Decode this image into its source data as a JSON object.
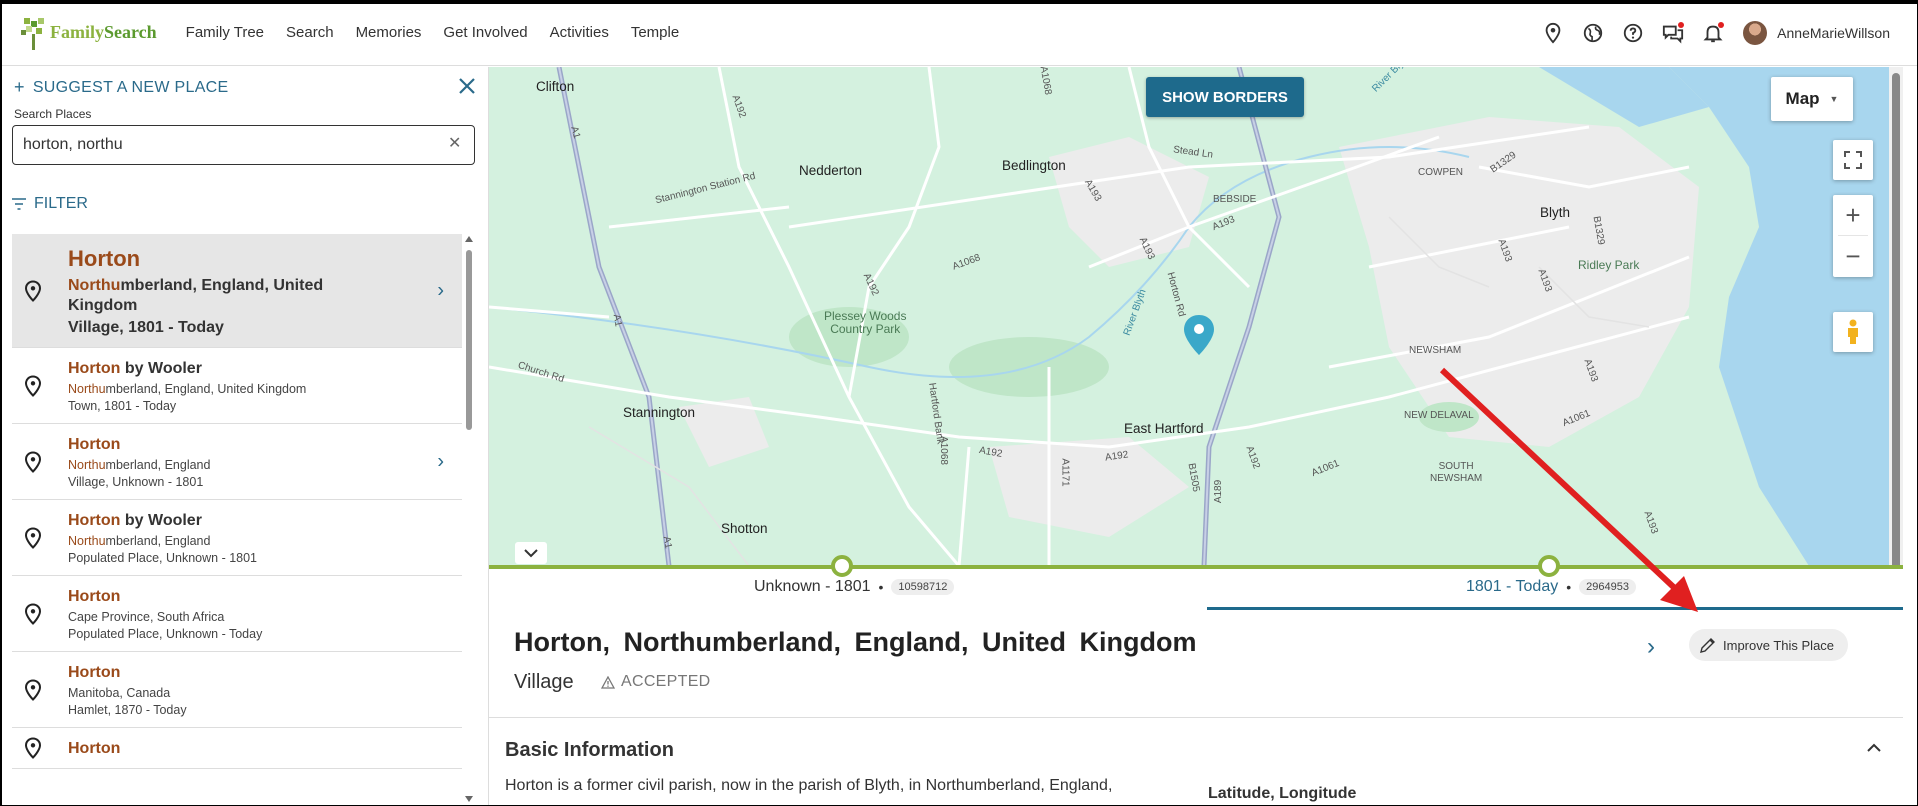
{
  "header": {
    "logo_text_1": "Family",
    "logo_text_2": "Search",
    "nav": [
      "Family Tree",
      "Search",
      "Memories",
      "Get Involved",
      "Activities",
      "Temple"
    ],
    "username": "AnneMarieWillson",
    "icons": [
      "location-pin-icon",
      "globe-icon",
      "help-icon",
      "chat-icon",
      "bell-icon"
    ]
  },
  "sidebar": {
    "suggest_label": "SUGGEST A NEW PLACE",
    "search_label": "Search Places",
    "search_value": "horton, northu",
    "filter_label": "FILTER",
    "results": [
      {
        "name_hl": "Horton",
        "name_rest": "",
        "loc_hl": "Northu",
        "loc_rest": "mberland, England, United Kingdom",
        "type": "Village, 1801 - Today",
        "selected": true,
        "chevron": true
      },
      {
        "name_hl": "Horton",
        "name_rest": " by Wooler",
        "loc_hl": "Northu",
        "loc_rest": "mberland, England, United Kingdom",
        "type": "Town, 1801 - Today",
        "selected": false,
        "chevron": false
      },
      {
        "name_hl": "Horton",
        "name_rest": "",
        "loc_hl": "Northu",
        "loc_rest": "mberland, England",
        "type": "Village, Unknown - 1801",
        "selected": false,
        "chevron": true
      },
      {
        "name_hl": "Horton",
        "name_rest": " by Wooler",
        "loc_hl": "Northu",
        "loc_rest": "mberland, England",
        "type": "Populated Place, Unknown - 1801",
        "selected": false,
        "chevron": false
      },
      {
        "name_hl": "Horton",
        "name_rest": "",
        "loc_hl": "",
        "loc_rest": "Cape Province, South Africa",
        "type": "Populated Place, Unknown - Today",
        "selected": false,
        "chevron": false
      },
      {
        "name_hl": "Horton",
        "name_rest": "",
        "loc_hl": "",
        "loc_rest": "Manitoba, Canada",
        "type": "Hamlet, 1870 - Today",
        "selected": false,
        "chevron": false
      },
      {
        "name_hl": "Horton",
        "name_rest": "",
        "loc_hl": "",
        "loc_rest": "",
        "type": "",
        "selected": false,
        "chevron": false
      }
    ]
  },
  "map": {
    "show_borders": "SHOW BORDERS",
    "map_type": "Map",
    "labels": {
      "clifton": "Clifton",
      "nedderton": "Nedderton",
      "bedlington": "Bedlington",
      "stannington": "Stannington",
      "east_hartford": "East Hartford",
      "shotton": "Shotton",
      "blyth": "Blyth",
      "ridley_park": "Ridley Park",
      "plessey_woods_1": "Plessey Woods",
      "plessey_woods_2": "Country Park",
      "cowpen": "COWPEN",
      "bebside": "BEBSIDE",
      "newsham": "NEWSHAM",
      "new_delaval": "NEW DELAVAL",
      "south_newsham_1": "SOUTH",
      "south_newsham_2": "NEWSHAM",
      "stannington_station_rd": "Stannington Station Rd",
      "church_rd": "Church Rd",
      "hartford_bank": "Hartford Bank",
      "horton_rd": "Horton Rd",
      "stead_ln": "Stead Ln",
      "river_blyth": "River Blyth",
      "river_blyth_2": "River Blyth",
      "a192_1": "A192",
      "a192_2": "A192",
      "a192_3": "A192",
      "a192_4": "A192",
      "a192_5": "A192",
      "a1068_1": "A1068",
      "a1068_2": "A1068",
      "a193_1": "A193",
      "a193_2": "A193",
      "a193_3": "A193",
      "a193_4": "A193",
      "a193_5": "A193",
      "a193_6": "A193",
      "a193_7": "A193",
      "a1061_1": "A1061",
      "a1061_2": "A1061",
      "a1_1": "A1",
      "a1_2": "A1",
      "a1_3": "A1",
      "a1171": "A1171",
      "a189": "A189",
      "b1505": "B1505",
      "b1329_1": "B1329",
      "b1329_2": "B1329",
      "a1068_3": "A1068"
    }
  },
  "timeline": {
    "left_label": "Unknown - 1801",
    "left_count": "10598712",
    "right_label": "1801 - Today",
    "right_count": "2964953",
    "dot": "•"
  },
  "details": {
    "title": "Horton,  Northumberland,  England,  United Kingdom",
    "type": "Village",
    "status": "ACCEPTED",
    "improve_label": "Improve This Place",
    "basic_title": "Basic Information",
    "basic_text": "Horton is a former civil parish, now in the parish of Blyth, in Northumberland, England,",
    "latlon_label": "Latitude, Longitude"
  },
  "colors": {
    "accent": "#1e6a8c",
    "link": "#2a6a8a",
    "highlight": "#9a4a1a",
    "timeline_green": "#8cb23f",
    "arrow_red": "#e02020",
    "map_bg": "#d4f1df",
    "water": "#a8d6ee"
  }
}
